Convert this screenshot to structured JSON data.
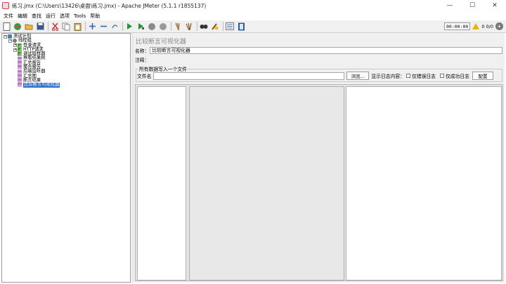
{
  "window": {
    "title": "练习.jmx (C:\\Users\\13426\\桌面\\练习.jmx) - Apache JMeter (5.1.1 r1855137)",
    "controls": [
      "—",
      "☐",
      "✕"
    ]
  },
  "menu": [
    "文件",
    "编辑",
    "查找",
    "运行",
    "选项",
    "Tools",
    "帮助"
  ],
  "toolbar": {
    "icons": [
      "new-icon",
      "templates-icon",
      "open-icon",
      "save-icon",
      "cut-icon",
      "copy-icon",
      "paste-icon",
      "expand-icon",
      "collapse-icon",
      "toggle-icon",
      "start-icon",
      "start-no-pause-icon",
      "stop-icon",
      "shutdown-icon",
      "clear-icon",
      "clear-all-icon",
      "search-icon",
      "reset-search-icon",
      "function-helper-icon",
      "help-icon"
    ],
    "timer": "00:00:00",
    "counts": "0 0/0"
  },
  "tree": [
    {
      "label": "测试计划",
      "indent": 0,
      "type": "plan",
      "expander": "−"
    },
    {
      "label": "线程组",
      "indent": 1,
      "type": "group",
      "expander": "−"
    },
    {
      "label": "登录请求",
      "indent": 2,
      "type": "sampler",
      "expander": "+"
    },
    {
      "label": "HTTP请求",
      "indent": 2,
      "type": "sampler",
      "expander": "+"
    },
    {
      "label": "调试取样器",
      "indent": 2,
      "type": "sampler",
      "expander": ""
    },
    {
      "label": "察看结果树",
      "indent": 2,
      "type": "listener",
      "expander": ""
    },
    {
      "label": "汇总报告",
      "indent": 2,
      "type": "listener",
      "expander": ""
    },
    {
      "label": "聚合报告",
      "indent": 2,
      "type": "listener",
      "expander": ""
    },
    {
      "label": "后端监听器",
      "indent": 2,
      "type": "listener",
      "expander": ""
    },
    {
      "label": "汇总图",
      "indent": 2,
      "type": "listener",
      "expander": ""
    },
    {
      "label": "断言结果",
      "indent": 2,
      "type": "listener",
      "expander": ""
    },
    {
      "label": "比较断言可视化器",
      "indent": 2,
      "type": "listener",
      "expander": "",
      "selected": true
    }
  ],
  "panel": {
    "title": "比较断言可视化器",
    "name_label": "名称：",
    "name_value": "比较断言可视化器",
    "comment_label": "注释：",
    "comment_value": "",
    "group_title": "所有数据写入一个文件",
    "filename_label": "文件名",
    "filename_value": "",
    "browse_button": "浏览...",
    "log_label": "显示日志内容：",
    "errors_only": "仅错误日志",
    "success_only": "仅成功日志",
    "config_button": "配置"
  }
}
